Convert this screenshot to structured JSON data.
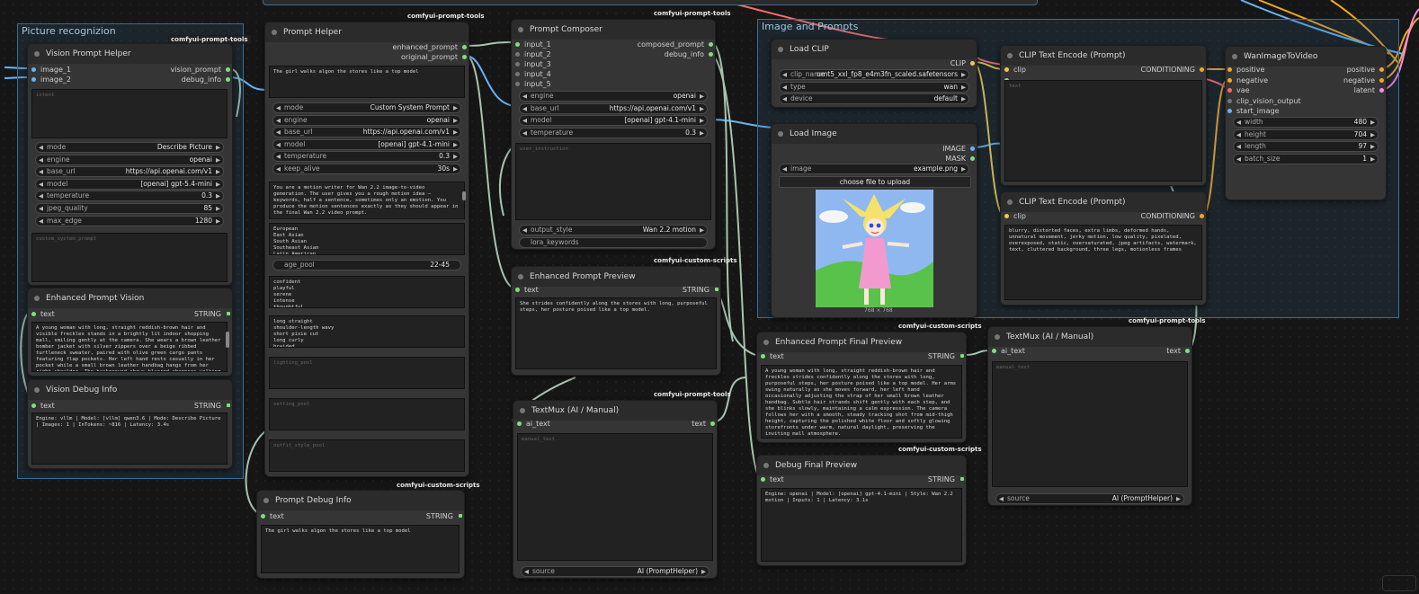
{
  "groups": {
    "picture": "Picture recognizion",
    "image_prompts": "Image and Prompts"
  },
  "badges": {
    "pt": "comfyui-prompt-tools",
    "cs": "comfyui-custom-scripts"
  },
  "vision_helper": {
    "title": "Vision Prompt Helper",
    "in1": "image_1",
    "in2": "image_2",
    "out1": "vision_prompt",
    "out2": "debug_info",
    "intent_ph": "intent",
    "widgets": [
      {
        "label": "mode",
        "value": "Describe Picture"
      },
      {
        "label": "engine",
        "value": "openai"
      },
      {
        "label": "base_url",
        "value": "https://api.openai.com/v1"
      },
      {
        "label": "model",
        "value": "[openai] gpt-5.4-mini"
      },
      {
        "label": "temperature",
        "value": "0.3"
      },
      {
        "label": "jpeg_quality",
        "value": "85"
      },
      {
        "label": "max_edge",
        "value": "1280"
      }
    ],
    "custom_ph": "custom_system_prompt"
  },
  "enh_vision": {
    "title": "Enhanced Prompt Vision",
    "in": "text",
    "out": "STRING",
    "text": "A young woman with long, straight reddish-brown hair and visible freckles stands in a brightly lit indoor shopping mall, smiling gently at the camera. She wears a brown leather bomber jacket with silver zippers over a beige ribbed turtleneck sweater, paired with olive green cargo pants featuring flap pockets. Her left hand rests casually in her pocket while a small brown leather handbag hangs from her right shoulder. The background shows blurred shoppers walking along a polished white floor, with storefronts"
  },
  "vision_debug": {
    "title": "Vision Debug Info",
    "in": "text",
    "out": "STRING",
    "text": "Engine: vllm | Model: [vllm] qwen3.6 | Mode: Describe Picture | Images: 1 | InTokens: ~816 | Latency: 3.4s"
  },
  "prompt_helper": {
    "title": "Prompt Helper",
    "out1": "enhanced_prompt",
    "out2": "original_prompt",
    "text": "The girl walks algon the stores like a top model",
    "widgets": [
      {
        "label": "mode",
        "value": "Custom System Prompt"
      },
      {
        "label": "engine",
        "value": "openai"
      },
      {
        "label": "base_url",
        "value": "https://api.openai.com/v1"
      },
      {
        "label": "model",
        "value": "[openai] gpt-4.1-mini"
      },
      {
        "label": "temperature",
        "value": "0.3"
      },
      {
        "label": "keep_alive",
        "value": "30s"
      }
    ],
    "system": "You are a motion writer for Wan 2.2 image-to-video generation. The user gives you a rough motion idea — keywords, half a sentence, sometimes only an emotion. You produce the motion sentences exactly as they should appear in the final Wan 2.2 video prompt.",
    "list1": "European\nEast Asian\nSouth Asian\nSoutheast Asian\nLatin American",
    "age_label": "age_pool",
    "age_value": "22-45",
    "list2": "confident\nplayful\nserene\nintense\nthoughtful",
    "list3": "long straight\nshoulder-length wavy\nshort pixie cut\nlong curly\nbraided",
    "ph_light": "lighting_pool",
    "ph_setting": "setting_pool",
    "ph_outfit": "outfit_style_pool"
  },
  "prompt_debug": {
    "title": "Prompt Debug Info",
    "in": "text",
    "out": "STRING",
    "text": "The girl walks algon the stores like a top model"
  },
  "composer": {
    "title": "Prompt Composer",
    "inputs": [
      "input_1",
      "input_2",
      "input_3",
      "input_4",
      "input_5"
    ],
    "out1": "composed_prompt",
    "out2": "debug_info",
    "widgets": [
      {
        "label": "engine",
        "value": "openai"
      },
      {
        "label": "base_url",
        "value": "https://api.openai.com/v1"
      },
      {
        "label": "model",
        "value": "[openai] gpt-4.1-mini"
      },
      {
        "label": "temperature",
        "value": "0.3"
      }
    ],
    "user_ph": "user_instruction",
    "out_style_label": "output_style",
    "out_style_value": "Wan 2.2 motion",
    "lora_ph": "lora_keywords"
  },
  "enh_preview": {
    "title": "Enhanced Prompt Preview",
    "in": "text",
    "out": "STRING",
    "text": "She strides confidently along the stores with long, purposeful steps, her posture poised like a top model."
  },
  "textmux1": {
    "title": "TextMux (AI / Manual)",
    "in": "ai_text",
    "out": "text",
    "ph": "manual_text",
    "src_label": "source",
    "src_value": "AI (PromptHelper)"
  },
  "load_clip": {
    "title": "Load CLIP",
    "out": "CLIP",
    "widgets": [
      {
        "label": "clip_name",
        "value": "umt5_xxl_fp8_e4m3fn_scaled.safetensors"
      },
      {
        "label": "type",
        "value": "wan"
      },
      {
        "label": "device",
        "value": "default"
      }
    ]
  },
  "load_image": {
    "title": "Load Image",
    "out1": "IMAGE",
    "out2": "MASK",
    "image_label": "image",
    "image_value": "example.png",
    "upload": "choose file to upload",
    "dims": "768 × 768"
  },
  "clip_pos": {
    "title": "CLIP Text Encode (Prompt)",
    "in": "clip",
    "out": "CONDITIONING",
    "ph": "text"
  },
  "clip_neg": {
    "title": "CLIP Text Encode (Prompt)",
    "in": "clip",
    "out": "CONDITIONING",
    "text": "blurry, distorted faces, extra limbs, deformed hands, unnatural movement, jerky motion, low quality, pixelated, overexposed, static, oversaturated, jpeg artifacts, watermark, text, cluttered background, three legs, motionless frames"
  },
  "wan": {
    "title": "WanImageToVideo",
    "inputs": [
      "positive",
      "negative",
      "vae",
      "clip_vision_output",
      "start_image"
    ],
    "outputs": [
      "positive",
      "negative",
      "latent"
    ],
    "widgets": [
      {
        "label": "width",
        "value": "480"
      },
      {
        "label": "height",
        "value": "704"
      },
      {
        "label": "length",
        "value": "97"
      },
      {
        "label": "batch_size",
        "value": "1"
      }
    ]
  },
  "enh_final": {
    "title": "Enhanced Prompt Final Preview",
    "in": "text",
    "out": "STRING",
    "text": "A young woman with long, straight reddish-brown hair and freckles strides confidently along the stores with long, purposeful steps, her posture poised like a top model. Her arms swing naturally as she moves forward, her left hand occasionally adjusting the strap of her small brown leather handbag. Subtle hair strands shift gently with each step, and she blinks slowly, maintaining a calm expression. The camera follows her with a smooth, steady tracking shot from mid-thigh height, capturing the polished white floor and softly glowing storefronts under warm, natural daylight, preserving the inviting mall atmosphere."
  },
  "debug_final": {
    "title": "Debug Final Preview",
    "in": "text",
    "out": "STRING",
    "text": "Engine: openai | Model: [openai] gpt-4.1-mini | Style: Wan 2.2 motion | Inputs: 1 | Latency: 3.1s"
  },
  "textmux2": {
    "title": "TextMux (AI / Manual)",
    "in": "ai_text",
    "out": "text",
    "ph": "manual_text",
    "src_label": "source",
    "src_value": "AI (PromptHelper)"
  },
  "colors": {
    "canvas": "#161616",
    "node": "#353535",
    "group": "#3a6f93",
    "string_wire": "#a8c4ad",
    "clip_wire": "#f2c94c",
    "cond_wire": "#f5a623",
    "image_wire": "#64b5f6",
    "vae_wire": "#ff6b6b"
  }
}
